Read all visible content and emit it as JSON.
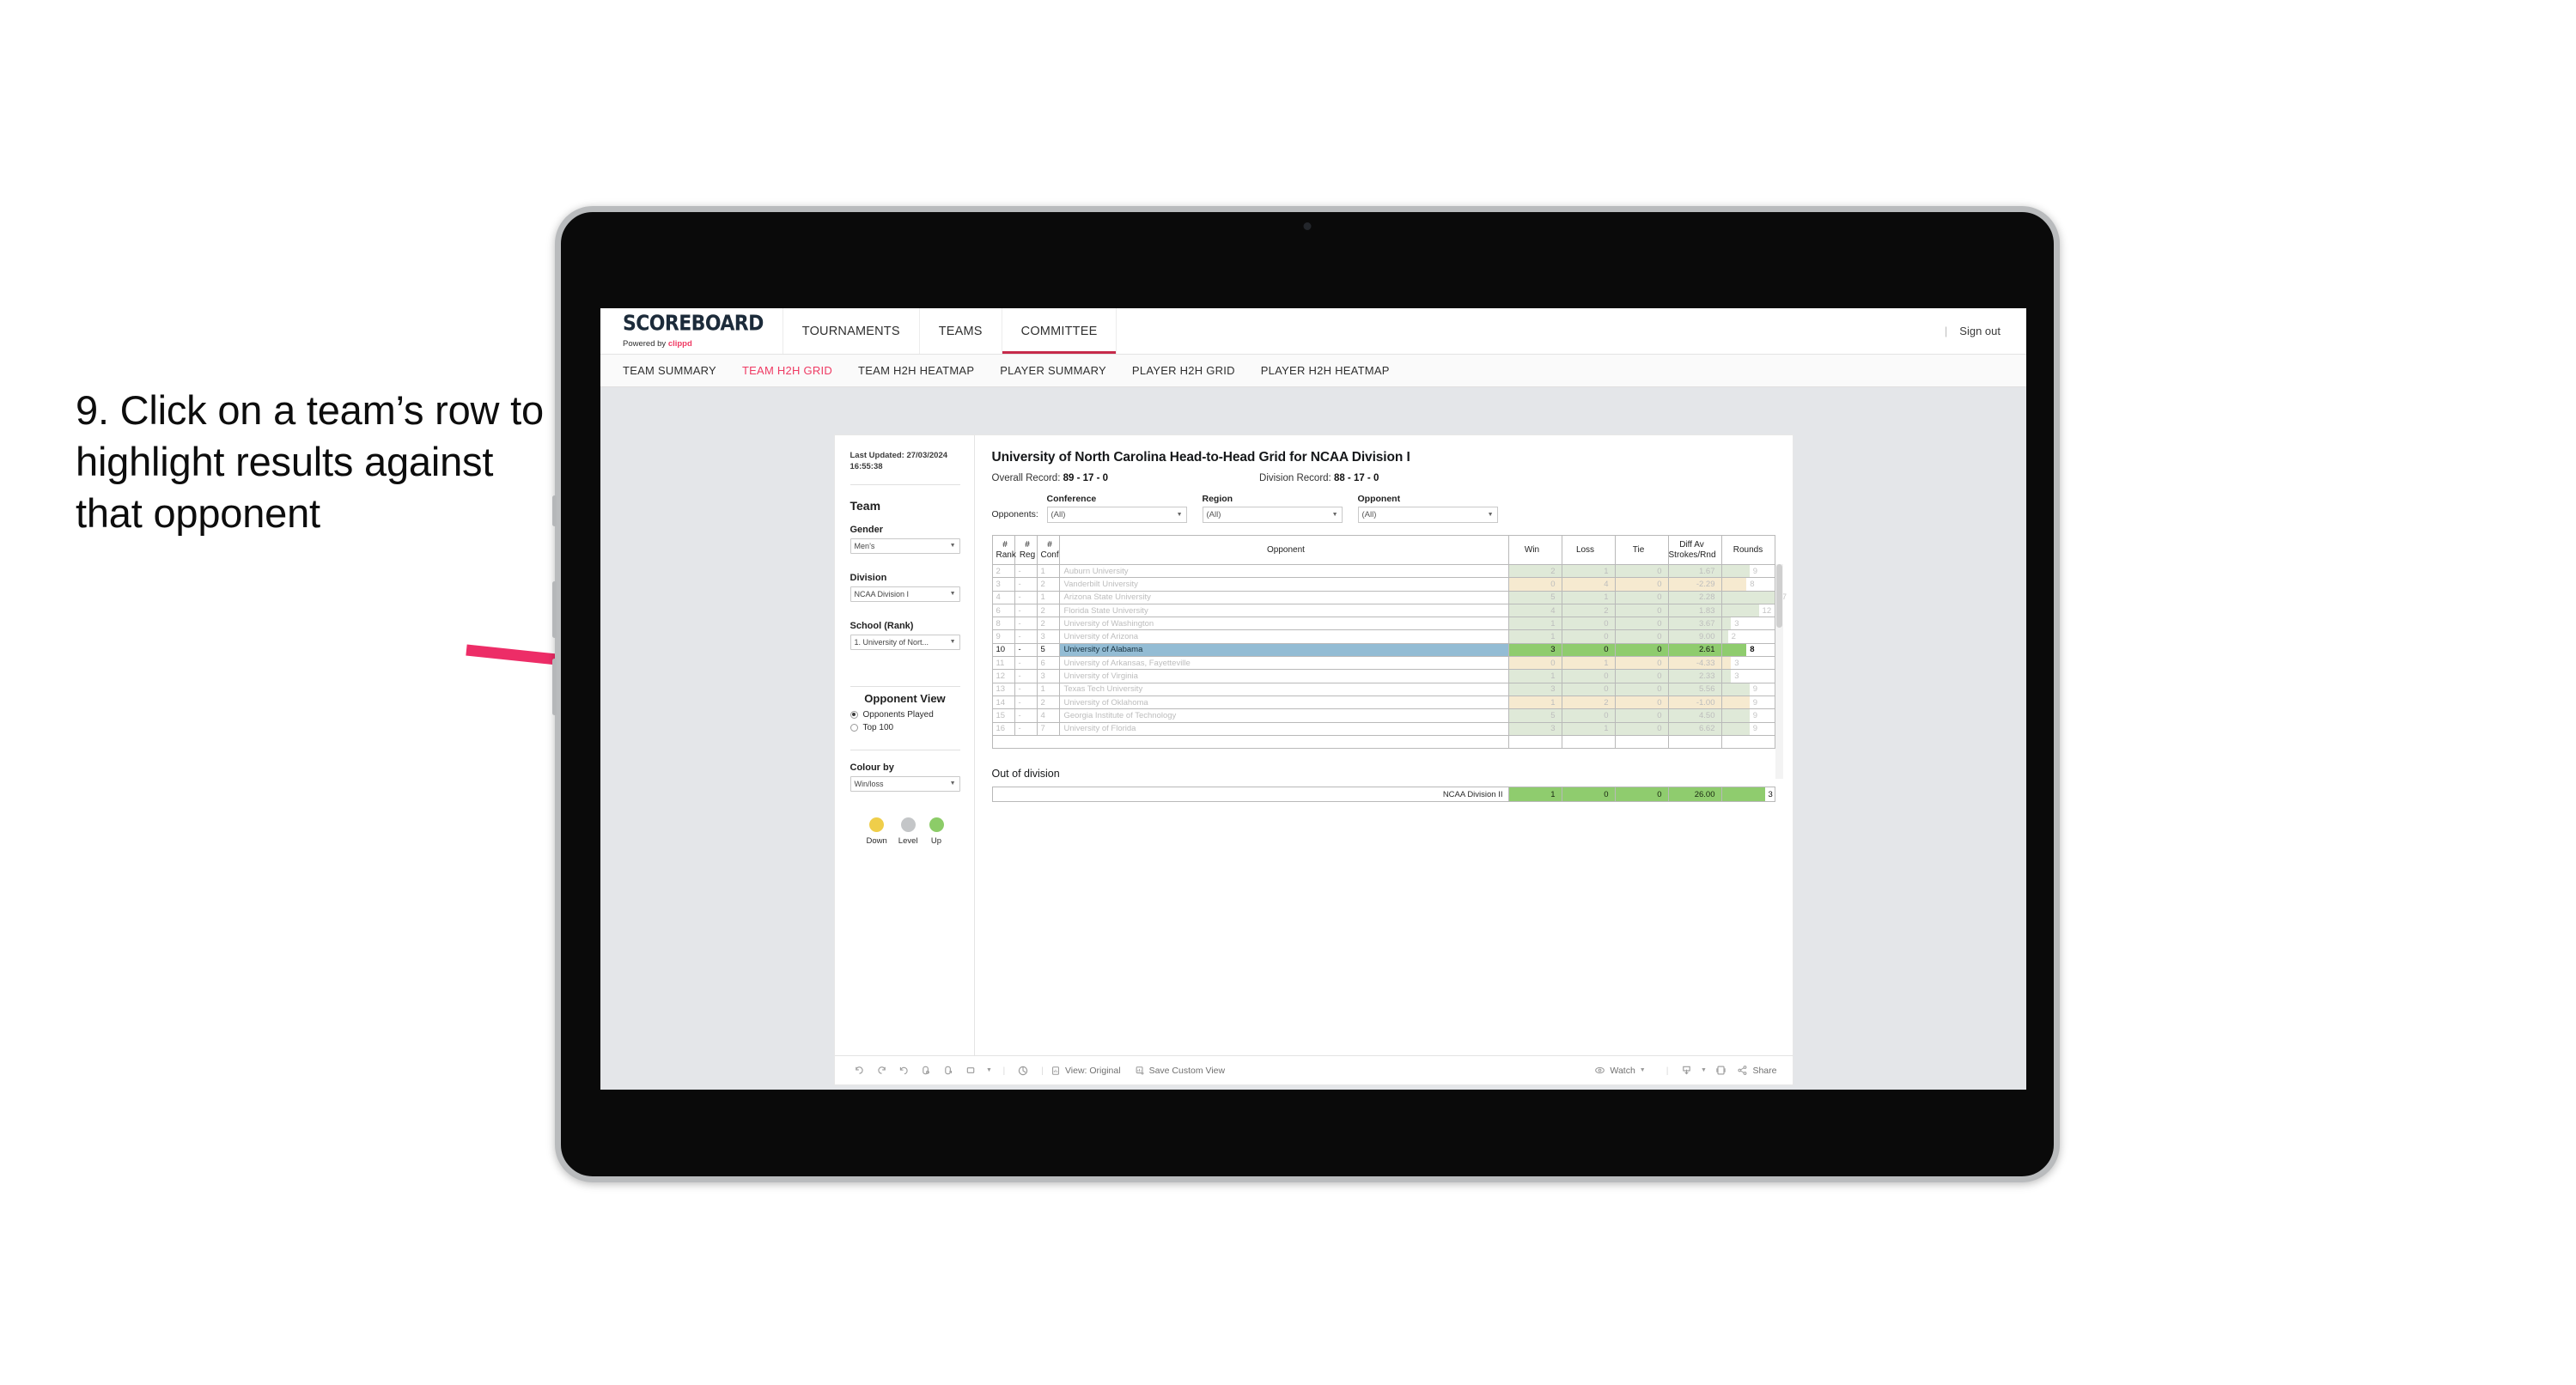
{
  "annotation": {
    "text": "9. Click on a team’s row to highlight results against that opponent",
    "arrow_color": "#ED2D67"
  },
  "app": {
    "brand": {
      "logo": "SCOREBOARD",
      "powered_prefix": "Powered by ",
      "powered_brand": "clippd"
    },
    "top_nav": [
      {
        "label": "TOURNAMENTS",
        "active": false
      },
      {
        "label": "TEAMS",
        "active": false
      },
      {
        "label": "COMMITTEE",
        "active": true
      }
    ],
    "top_right": {
      "divider": "|",
      "sign_out": "Sign out"
    },
    "sub_nav": [
      {
        "label": "TEAM SUMMARY",
        "active": false
      },
      {
        "label": "TEAM H2H GRID",
        "active": true
      },
      {
        "label": "TEAM H2H HEATMAP",
        "active": false
      },
      {
        "label": "PLAYER SUMMARY",
        "active": false
      },
      {
        "label": "PLAYER H2H GRID",
        "active": false
      },
      {
        "label": "PLAYER H2H HEATMAP",
        "active": false
      }
    ],
    "accent_color": "#EF3A63",
    "tab_underline_color": "#C62A4A"
  },
  "sidebar": {
    "last_updated": "Last Updated: 27/03/2024 16:55:38",
    "team_heading": "Team",
    "gender": {
      "label": "Gender",
      "value": "Men’s"
    },
    "division": {
      "label": "Division",
      "value": "NCAA Division I"
    },
    "school": {
      "label": "School (Rank)",
      "value": "1. University of Nort..."
    },
    "opponent_view": {
      "heading": "Opponent View",
      "options": [
        {
          "label": "Opponents Played",
          "selected": true
        },
        {
          "label": "Top 100",
          "selected": false
        }
      ]
    },
    "colour_by": {
      "label": "Colour by",
      "value": "Win/loss"
    },
    "legend": [
      {
        "label": "Down",
        "color": "#EFCE4A"
      },
      {
        "label": "Level",
        "color": "#C4C6C8"
      },
      {
        "label": "Up",
        "color": "#8CCC68"
      }
    ]
  },
  "main": {
    "title": "University of North Carolina Head-to-Head Grid for NCAA Division I",
    "overall_record_label": "Overall Record: ",
    "overall_record_value": "89 - 17 - 0",
    "division_record_label": "Division Record: ",
    "division_record_value": "88 - 17 - 0",
    "opponents_label": "Opponents:",
    "filters": [
      {
        "label": "Conference",
        "value": "(All)"
      },
      {
        "label": "Region",
        "value": "(All)"
      },
      {
        "label": "Opponent",
        "value": "(All)"
      }
    ]
  },
  "chart_data": {
    "type": "table",
    "title": "University of North Carolina Head-to-Head Grid for NCAA Division I",
    "columns": [
      "# Rank",
      "# Reg",
      "# Conf",
      "Opponent",
      "Win",
      "Loss",
      "Tie",
      "Diff Av Strokes/Rnd",
      "Rounds"
    ],
    "column_headers_display": [
      {
        "line1": "#",
        "line2": "Rank"
      },
      {
        "line1": "#",
        "line2": "Reg"
      },
      {
        "line1": "#",
        "line2": "Conf"
      },
      {
        "line1": "Opponent",
        "line2": ""
      },
      {
        "line1": "Win",
        "line2": ""
      },
      {
        "line1": "Loss",
        "line2": ""
      },
      {
        "line1": "Tie",
        "line2": ""
      },
      {
        "line1": "Diff Av",
        "line2": "Strokes/Rnd"
      },
      {
        "line1": "Rounds",
        "line2": ""
      }
    ],
    "rounds_max": 17,
    "rows": [
      {
        "rank": "2",
        "reg": "-",
        "conf": "1",
        "opponent": "Auburn University",
        "win": "2",
        "loss": "1",
        "tie": "0",
        "diff": "1.67",
        "rounds": 9,
        "tone": "win",
        "selected": false
      },
      {
        "rank": "3",
        "reg": "-",
        "conf": "2",
        "opponent": "Vanderbilt University",
        "win": "0",
        "loss": "4",
        "tie": "0",
        "diff": "-2.29",
        "rounds": 8,
        "tone": "loss",
        "selected": false
      },
      {
        "rank": "4",
        "reg": "-",
        "conf": "1",
        "opponent": "Arizona State University",
        "win": "5",
        "loss": "1",
        "tie": "0",
        "diff": "2.28",
        "rounds": 17,
        "tone": "win",
        "selected": false
      },
      {
        "rank": "6",
        "reg": "-",
        "conf": "2",
        "opponent": "Florida State University",
        "win": "4",
        "loss": "2",
        "tie": "0",
        "diff": "1.83",
        "rounds": 12,
        "tone": "win",
        "selected": false
      },
      {
        "rank": "8",
        "reg": "-",
        "conf": "2",
        "opponent": "University of Washington",
        "win": "1",
        "loss": "0",
        "tie": "0",
        "diff": "3.67",
        "rounds": 3,
        "tone": "win",
        "selected": false
      },
      {
        "rank": "9",
        "reg": "-",
        "conf": "3",
        "opponent": "University of Arizona",
        "win": "1",
        "loss": "0",
        "tie": "0",
        "diff": "9.00",
        "rounds": 2,
        "tone": "win",
        "selected": false
      },
      {
        "rank": "10",
        "reg": "-",
        "conf": "5",
        "opponent": "University of Alabama",
        "win": "3",
        "loss": "0",
        "tie": "0",
        "diff": "2.61",
        "rounds": 8,
        "tone": "win",
        "selected": true
      },
      {
        "rank": "11",
        "reg": "-",
        "conf": "6",
        "opponent": "University of Arkansas, Fayetteville",
        "win": "0",
        "loss": "1",
        "tie": "0",
        "diff": "-4.33",
        "rounds": 3,
        "tone": "loss",
        "selected": false
      },
      {
        "rank": "12",
        "reg": "-",
        "conf": "3",
        "opponent": "University of Virginia",
        "win": "1",
        "loss": "0",
        "tie": "0",
        "diff": "2.33",
        "rounds": 3,
        "tone": "win",
        "selected": false
      },
      {
        "rank": "13",
        "reg": "-",
        "conf": "1",
        "opponent": "Texas Tech University",
        "win": "3",
        "loss": "0",
        "tie": "0",
        "diff": "5.56",
        "rounds": 9,
        "tone": "win",
        "selected": false
      },
      {
        "rank": "14",
        "reg": "-",
        "conf": "2",
        "opponent": "University of Oklahoma",
        "win": "1",
        "loss": "2",
        "tie": "0",
        "diff": "-1.00",
        "rounds": 9,
        "tone": "loss",
        "selected": false
      },
      {
        "rank": "15",
        "reg": "-",
        "conf": "4",
        "opponent": "Georgia Institute of Technology",
        "win": "5",
        "loss": "0",
        "tie": "0",
        "diff": "4.50",
        "rounds": 9,
        "tone": "win",
        "selected": false
      },
      {
        "rank": "16",
        "reg": "-",
        "conf": "7",
        "opponent": "University of Florida",
        "win": "3",
        "loss": "1",
        "tie": "0",
        "diff": "6.62",
        "rounds": 9,
        "tone": "win",
        "selected": false
      }
    ],
    "out_of_division": {
      "heading": "Out of division",
      "rows": [
        {
          "name": "NCAA Division II",
          "win": "1",
          "loss": "0",
          "tie": "0",
          "diff": "26.00",
          "rounds": 3,
          "rounds_fill_pct": 82
        }
      ]
    },
    "colors": {
      "win_fill": "#DFE9D8",
      "loss_fill": "#F6EAD0",
      "selected_green": "#8FCC6E",
      "selected_row_blue": "#93BCD4",
      "rounds_bar_faded_win": "#DFE9D8",
      "rounds_bar_faded_loss": "#F6EAD0"
    }
  },
  "toolbar": {
    "view_original": "View: Original",
    "save_custom_view": "Save Custom View",
    "watch": "Watch",
    "share": "Share"
  }
}
